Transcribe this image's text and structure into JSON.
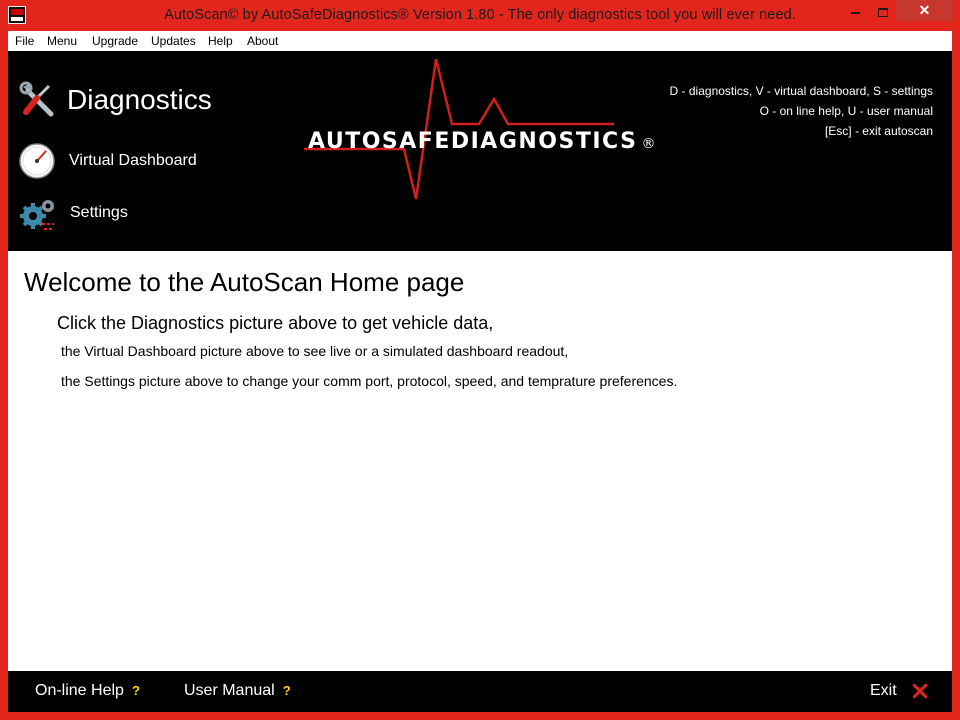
{
  "window": {
    "title": "AutoScan© by AutoSafeDiagnostics® Version 1.80 - The only diagnostics tool you will ever need.",
    "close_glyph": "✕",
    "frame_color": "#e2261d",
    "close_color": "#c7372f"
  },
  "menu": {
    "items": [
      "File",
      "Menu",
      "Upgrade",
      "Updates",
      "Help",
      "About"
    ]
  },
  "header": {
    "nav": {
      "diagnostics": {
        "label": "Diagnostics",
        "icon": "wrench-screwdriver-icon"
      },
      "virtual_dashboard": {
        "label": "Virtual Dashboard",
        "icon": "gauge-icon"
      },
      "settings": {
        "label": "Settings",
        "icon": "gears-icon"
      }
    },
    "logo": {
      "text": "AUTOSAFEDIAGNOSTICS",
      "reg": "®",
      "pulse_color": "#d21e1e"
    },
    "shortcuts": [
      "D - diagnostics, V - virtual dashboard, S - settings",
      "O - on line help, U - user manual",
      "[Esc] - exit autoscan"
    ]
  },
  "main": {
    "welcome": "Welcome to the AutoScan Home page",
    "line1": "Click the Diagnostics picture above to get vehicle data,",
    "line2": "the Virtual Dashboard picture above to see live or a simulated dashboard readout,",
    "line3": "the Settings picture above to change your comm port, protocol, speed, and temprature preferences."
  },
  "footer": {
    "online_help": "On-line Help",
    "user_manual": "User Manual",
    "help_mark": "?",
    "exit": "Exit",
    "exit_icon": "red-x-icon"
  },
  "colors": {
    "header_bg": "#000000",
    "accent_red": "#e2261d",
    "question_mark": "#ffd700"
  }
}
